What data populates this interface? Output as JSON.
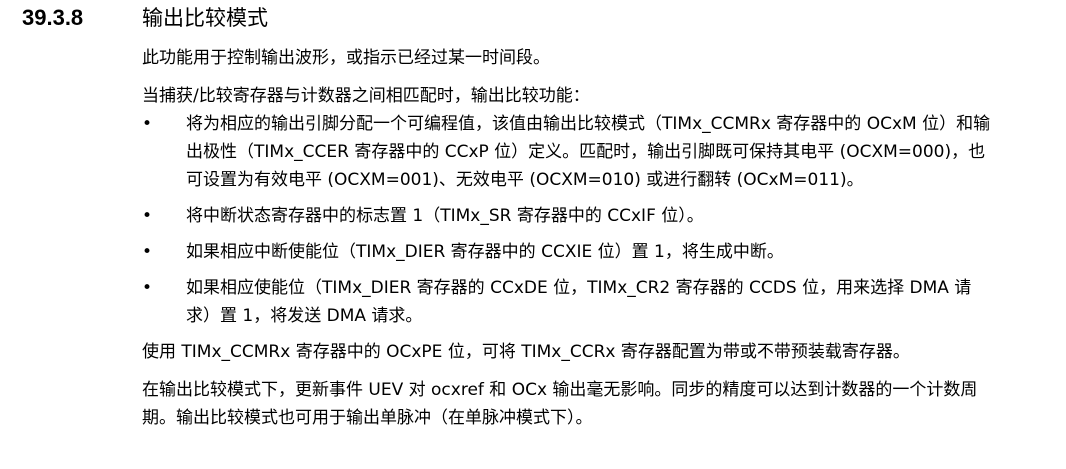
{
  "heading": {
    "number": "39.3.8",
    "title": "输出比较模式"
  },
  "paragraphs": {
    "intro1": "此功能用于控制输出波形，或指示已经过某一时间段。",
    "intro2": "当捕获/比较寄存器与计数器之间相匹配时，输出比较功能：",
    "preload": "使用 TIMx_CCMRx 寄存器中的 OCxPE 位，可将 TIMx_CCRx 寄存器配置为带或不带预装载寄存器。",
    "last": "在输出比较模式下，更新事件 UEV 对 ocxref 和 OCx 输出毫无影响。同步的精度可以达到计数器的一个计数周期。输出比较模式也可用于输出单脉冲（在单脉冲模式下）。"
  },
  "bullet_symbol": "•",
  "bullets": [
    "将为相应的输出引脚分配一个可编程值，该值由输出比较模式（TIMx_CCMRx 寄存器中的 OCxM 位）和输出极性（TIMx_CCER 寄存器中的 CCxP 位）定义。匹配时，输出引脚既可保持其电平 (OCXM=000)，也可设置为有效电平 (OCXM=001)、无效电平 (OCXM=010) 或进行翻转 (OCxM=011)。",
    "将中断状态寄存器中的标志置 1（TIMx_SR 寄存器中的 CCxIF 位）。",
    "如果相应中断使能位（TIMx_DIER 寄存器中的 CCXIE 位）置 1，将生成中断。",
    "如果相应使能位（TIMx_DIER 寄存器的 CCxDE 位，TIMx_CR2 寄存器的 CCDS 位，用来选择 DMA 请求）置 1，将发送 DMA 请求。"
  ]
}
